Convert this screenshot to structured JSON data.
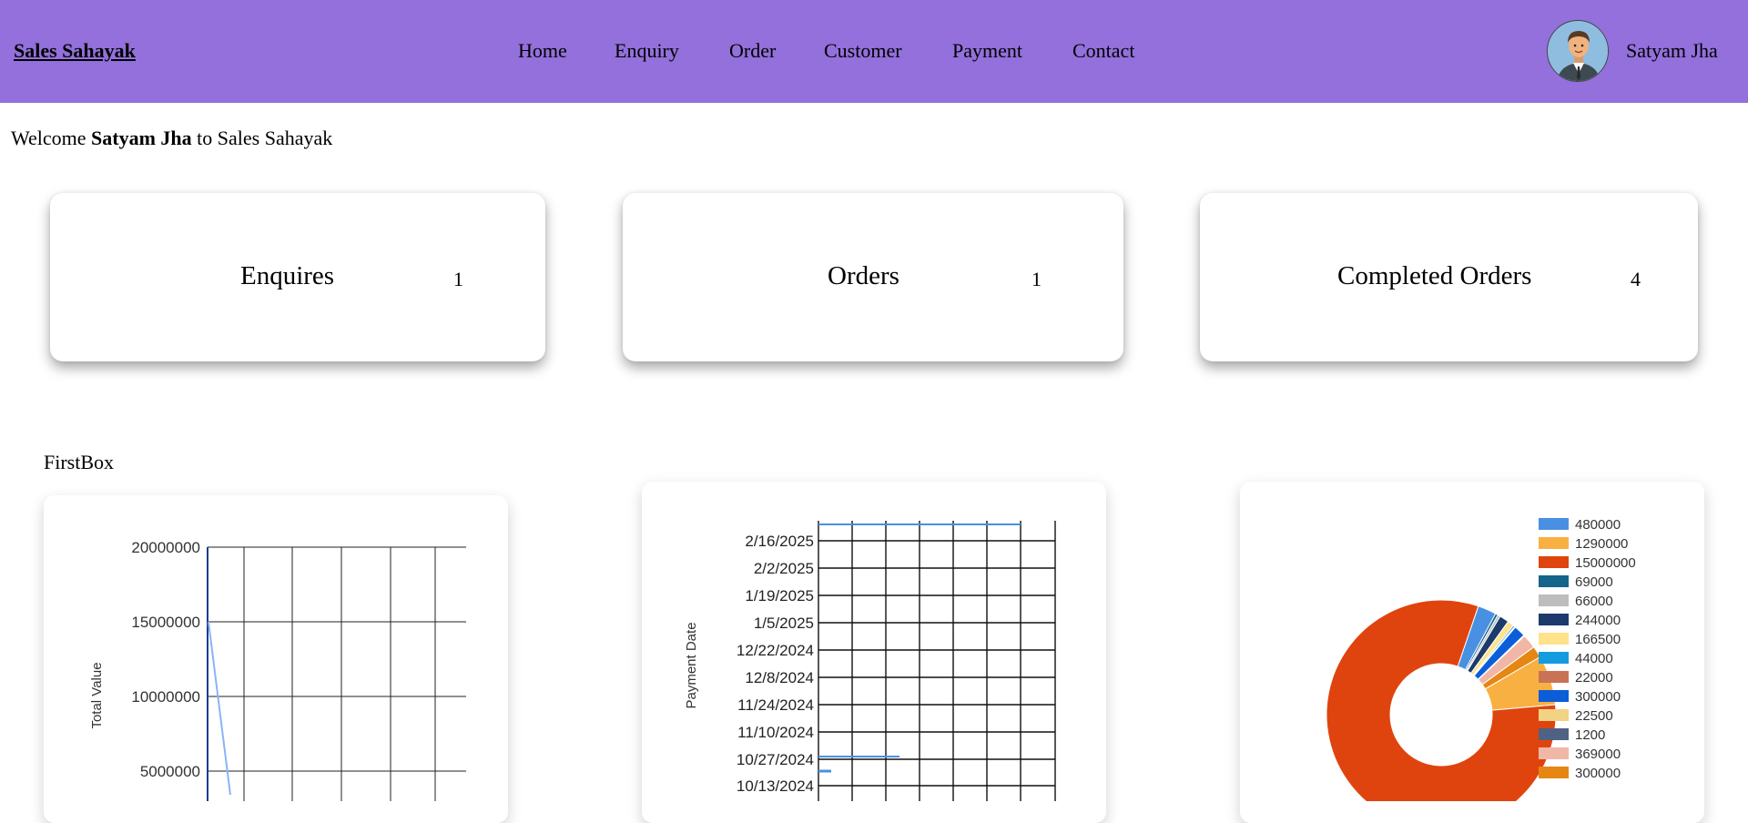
{
  "navbar": {
    "brand": "Sales Sahayak",
    "links": [
      "Home",
      "Enquiry",
      "Order",
      "Customer",
      "Payment",
      "Contact"
    ],
    "user_name": "Satyam Jha",
    "avatar_icon": "user-avatar-icon",
    "background": "#9370db"
  },
  "welcome": {
    "prefix": "Welcome ",
    "name": "Satyam Jha",
    "suffix": " to Sales Sahayak"
  },
  "stats": [
    {
      "label": "Enquires",
      "count": "1"
    },
    {
      "label": "Orders",
      "count": "1"
    },
    {
      "label": "Completed Orders",
      "count": "4"
    }
  ],
  "section_title": "FirstBox",
  "charts": {
    "line": {
      "chart_data": {
        "type": "line",
        "ylabel": "Total Value",
        "y_ticks": [
          "20000000",
          "15000000",
          "10000000",
          "5000000"
        ],
        "ylim": [
          0,
          20000000
        ],
        "series": [
          {
            "values": [
              15000000,
              0
            ]
          }
        ],
        "grid": true,
        "color": "#8ab4f8"
      }
    },
    "timeline": {
      "chart_data": {
        "type": "bar",
        "ylabel": "Payment Date",
        "y_ticks": [
          "2/16/2025",
          "2/2/2025",
          "1/19/2025",
          "1/5/2025",
          "12/22/2024",
          "12/8/2024",
          "11/24/2024",
          "11/10/2024",
          "10/27/2024",
          "10/13/2024"
        ],
        "grid": true,
        "color": "#4a90e2"
      }
    },
    "donut": {
      "chart_data": {
        "type": "pie",
        "donut": true,
        "legend_position": "right",
        "slices": [
          {
            "label": "480000",
            "value": 480000,
            "color": "#4a90e2"
          },
          {
            "label": "1290000",
            "value": 1290000,
            "color": "#f9b042"
          },
          {
            "label": "15000000",
            "value": 15000000,
            "color": "#e0440e"
          },
          {
            "label": "69000",
            "value": 69000,
            "color": "#15648a"
          },
          {
            "label": "66000",
            "value": 66000,
            "color": "#bdbdbd"
          },
          {
            "label": "244000",
            "value": 244000,
            "color": "#1c3a6b"
          },
          {
            "label": "166500",
            "value": 166500,
            "color": "#ffe28a"
          },
          {
            "label": "44000",
            "value": 44000,
            "color": "#159be0"
          },
          {
            "label": "22000",
            "value": 22000,
            "color": "#c97256"
          },
          {
            "label": "300000",
            "value": 300000,
            "color": "#0b5ed7"
          },
          {
            "label": "22500",
            "value": 22500,
            "color": "#f2d385"
          },
          {
            "label": "1200",
            "value": 1200,
            "color": "#4f6283"
          },
          {
            "label": "369000",
            "value": 369000,
            "color": "#f0b7a6"
          },
          {
            "label": "300000",
            "value": 300000,
            "color": "#e68613"
          }
        ]
      }
    }
  }
}
